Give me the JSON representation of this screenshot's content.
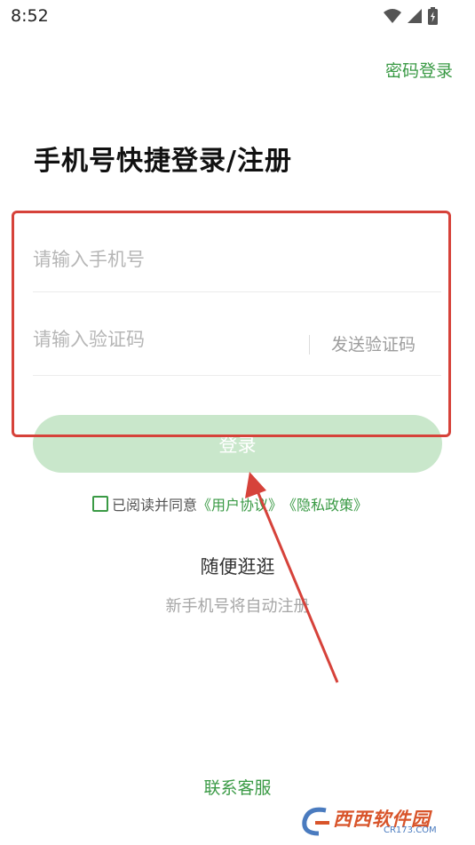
{
  "status_bar": {
    "time": "8:52"
  },
  "header": {
    "password_login_label": "密码登录"
  },
  "main": {
    "title": "手机号快捷登录/注册",
    "phone_placeholder": "请输入手机号",
    "code_placeholder": "请输入验证码",
    "send_code_label": "发送验证码",
    "login_label": "登录",
    "agreement": {
      "prefix": "已阅读并同意",
      "user_agreement": "《用户协议》",
      "privacy_policy": "《隐私政策》"
    },
    "browse_label": "随便逛逛",
    "auto_register_note": "新手机号将自动注册"
  },
  "footer": {
    "contact_label": "联系客服"
  },
  "watermark": {
    "text": "西西软件园",
    "url": "CR173.COM"
  },
  "colors": {
    "accent_green": "#3a9a45",
    "login_button_disabled": "#c9e7cb",
    "annotation_red": "#d6423a"
  },
  "icons": [
    "wifi-icon",
    "signal-icon",
    "battery-icon",
    "checkbox-icon",
    "annotation-arrow"
  ]
}
